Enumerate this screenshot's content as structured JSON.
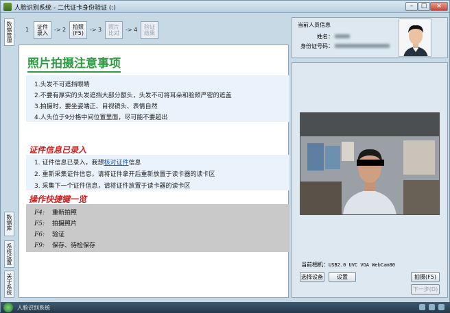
{
  "window": {
    "title": "人脸识别系统 - 二代证卡身份验证 (:)",
    "minimize": "–",
    "maximize": "□",
    "close": "×"
  },
  "side_tabs": [
    "数据管理",
    "数据库",
    "系统设置",
    "关于系统"
  ],
  "steps": [
    {
      "num": "1",
      "label": [
        "证件",
        "录入"
      ],
      "enabled": true
    },
    {
      "num": "2",
      "label": [
        "拍照",
        "(F5)"
      ],
      "enabled": true
    },
    {
      "num": "3",
      "label": [
        "照片",
        "比对"
      ],
      "enabled": false
    },
    {
      "num": "4",
      "label": [
        "验证",
        "结果"
      ],
      "enabled": false
    }
  ],
  "step_arrow": "->",
  "notice": {
    "title": "照片拍摄注意事项",
    "items": [
      "1.头发不可遮挡眼睛",
      "2.不要有厚实的头发遮挡大部分额头，头发不可将耳朵和脸颊严密的遮盖",
      "3.拍摄时，要坐姿端正、目视镜头、表情自然",
      "4.人头位于9分格中间位置里面，尽可能不要超出"
    ]
  },
  "id_entered": {
    "title": "证件信息已录入",
    "item1_pre": "1.   证件信息已录入，我想",
    "item1_link": "核对证件",
    "item1_post": "信息",
    "item2": "2.   重新采集证件信息，请将证件拿开后重新放置于读卡器的读卡区",
    "item3": "3.   采集下一个证件信息，请将证件放置于读卡器的读卡区"
  },
  "shortcuts": {
    "title": "操作快捷键一览",
    "items": [
      {
        "key": "F4:",
        "desc": "重新拍照"
      },
      {
        "key": "F5:",
        "desc": "拍摄照片"
      },
      {
        "key": "F6:",
        "desc": "验证"
      },
      {
        "key": "F9:",
        "desc": "保存、待检保存"
      }
    ]
  },
  "person": {
    "title": "当前人员信息",
    "name_label": "姓名：",
    "id_label": "身份证号码："
  },
  "camera": {
    "current_label": "当前相机：",
    "current_value": "USB2.0 UVC VGA WebCam80",
    "select_button": "选择设备",
    "settings_button": "设置",
    "capture_button": "拍摄(F5)",
    "next_button": "下一步(D)"
  },
  "taskbar": {
    "item": "人脸识别系统"
  }
}
